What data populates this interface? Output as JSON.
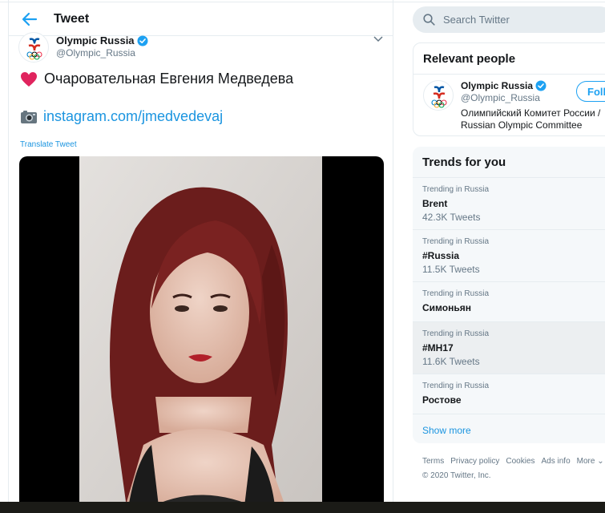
{
  "header": {
    "title": "Tweet"
  },
  "tweet": {
    "author_name": "Olympic Russia",
    "author_handle": "@Olympic_Russia",
    "line1": "Очаровательная Евгения Медведева",
    "link": "instagram.com/jmedvedevaj",
    "translate_label": "Translate Tweet"
  },
  "search": {
    "placeholder": "Search Twitter"
  },
  "relevant_people": {
    "title": "Relevant people",
    "name": "Olympic Russia",
    "handle": "@Olympic_Russia",
    "follow_label": "Follow",
    "bio_line1": "Олимпийский Комитет России /",
    "bio_line2": "Russian Olympic Committee"
  },
  "trends": {
    "title": "Trends for you",
    "items": [
      {
        "context": "Trending in Russia",
        "name": "Brent",
        "count": "42.3K Tweets"
      },
      {
        "context": "Trending in Russia",
        "name": "#Russia",
        "count": "11.5K Tweets"
      },
      {
        "context": "Trending in Russia",
        "name": "Симоньян",
        "count": ""
      },
      {
        "context": "Trending in Russia",
        "name": "#MH17",
        "count": "11.6K Tweets"
      },
      {
        "context": "Trending in Russia",
        "name": "Ростове",
        "count": ""
      }
    ],
    "show_more": "Show more"
  },
  "footer": {
    "links": [
      "Terms",
      "Privacy policy",
      "Cookies",
      "Ads info",
      "More ⌄"
    ],
    "copyright": "© 2020 Twitter, Inc."
  },
  "colors": {
    "accent": "#1da1f2",
    "link": "#1b95e0",
    "heart": "#e0245e",
    "border": "#e6ecf0",
    "card_bg": "#f5f8fa"
  }
}
